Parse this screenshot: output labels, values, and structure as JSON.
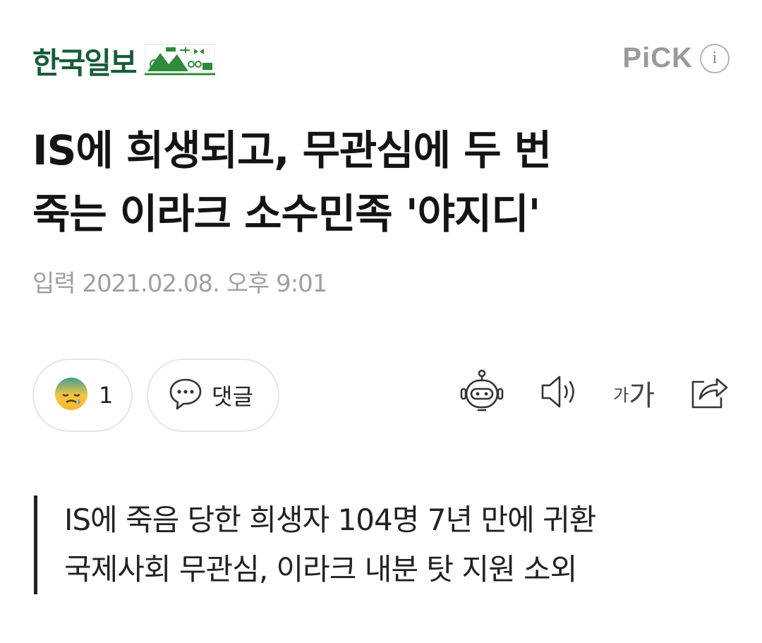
{
  "header": {
    "press_name": "한국일보",
    "emblem": "hankook-ilbo-green-emblem-icon",
    "pick_label": "PiCK",
    "info_label": "i"
  },
  "article": {
    "title_lines": [
      "IS에 희생되고, 무관심에 두 번",
      "죽는 이라크 소수민족 '야지디'"
    ],
    "date_label": "입력",
    "date_value": "2021.02.08. 오후 9:01"
  },
  "toolbar": {
    "reaction_icon": "sad-face-emoji-icon",
    "reaction_count": "1",
    "comment_icon": "speech-bubble-icon",
    "comment_label": "댓글",
    "summary_bot_icon": "robot-icon",
    "tts_icon": "speaker-icon",
    "fontsize_small": "가",
    "fontsize_large": "가",
    "share_icon": "share-icon"
  },
  "summary": {
    "lines": [
      "IS에 죽음 당한 희생자 104명 7년 만에 귀환",
      "국제사회 무관심, 이라크 내분 탓 지원 소외"
    ]
  },
  "colors": {
    "brand_green": "#175c3a",
    "pick_gray": "#9a9a9a",
    "date_gray": "#a0a0a0",
    "summary_bar": "#222222"
  }
}
